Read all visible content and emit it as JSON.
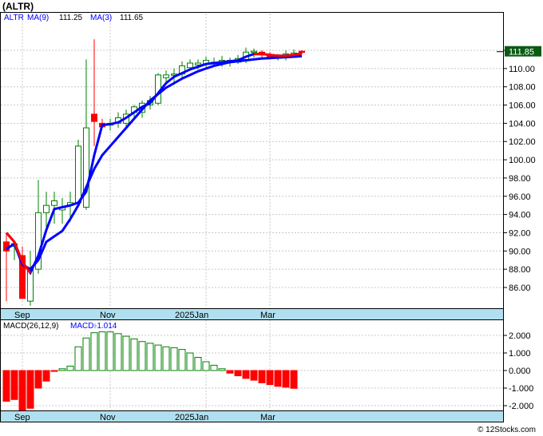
{
  "title": "(ALTR)",
  "watermark": "© 12Stocks.com",
  "chart_data": [
    {
      "type": "candlestick",
      "ticker_label": "ALTR",
      "legend": [
        {
          "label": "MA(9)",
          "value": "111.25",
          "color": "#0000ff"
        },
        {
          "label": "MA(3)",
          "value": "111.65",
          "color": "#0000ff"
        }
      ],
      "last_price": "111.85",
      "ylim": [
        84,
        113.6
      ],
      "yticks": [
        "86.00",
        "88.00",
        "90.00",
        "92.00",
        "94.00",
        "96.00",
        "98.00",
        "100.00",
        "102.00",
        "104.00",
        "106.00",
        "108.00",
        "110.00",
        "112.00"
      ],
      "xticks": [
        "Sep",
        "Nov",
        "2025Jan",
        "Mar"
      ],
      "colors": {
        "up": "#008000",
        "down": "#ff0000",
        "ma": "#0000ff",
        "ma_short": "#ff0000",
        "axis_band": "#b0e0f0"
      },
      "candles": [
        {
          "o": 91.0,
          "h": 92.0,
          "l": 84.5,
          "c": 90.0
        },
        {
          "o": 90.5,
          "h": 91.0,
          "l": 89.0,
          "c": 90.8
        },
        {
          "o": 89.5,
          "h": 90.5,
          "l": 84.8,
          "c": 84.8
        },
        {
          "o": 84.5,
          "h": 90.0,
          "l": 84.0,
          "c": 88.0
        },
        {
          "o": 88.0,
          "h": 97.8,
          "l": 87.5,
          "c": 94.2
        },
        {
          "o": 94.2,
          "h": 96.5,
          "l": 92.5,
          "c": 95.0
        },
        {
          "o": 95.0,
          "h": 96.5,
          "l": 93.0,
          "c": 95.5
        },
        {
          "o": 94.5,
          "h": 95.8,
          "l": 93.0,
          "c": 94.8
        },
        {
          "o": 95.0,
          "h": 96.5,
          "l": 93.2,
          "c": 95.3
        },
        {
          "o": 95.3,
          "h": 102.2,
          "l": 94.8,
          "c": 101.5
        },
        {
          "o": 94.8,
          "h": 111.0,
          "l": 94.5,
          "c": 103.5
        },
        {
          "o": 105.0,
          "h": 113.2,
          "l": 101.5,
          "c": 104.2
        },
        {
          "o": 104.0,
          "h": 104.5,
          "l": 103.5,
          "c": 103.6
        },
        {
          "o": 103.8,
          "h": 104.5,
          "l": 103.2,
          "c": 104.0
        },
        {
          "o": 104.0,
          "h": 105.2,
          "l": 103.5,
          "c": 104.6
        },
        {
          "o": 104.0,
          "h": 105.5,
          "l": 103.5,
          "c": 105.0
        },
        {
          "o": 105.2,
          "h": 106.0,
          "l": 104.5,
          "c": 105.8
        },
        {
          "o": 105.2,
          "h": 106.5,
          "l": 104.6,
          "c": 106.2
        },
        {
          "o": 106.0,
          "h": 107.0,
          "l": 105.5,
          "c": 106.5
        },
        {
          "o": 106.2,
          "h": 109.5,
          "l": 106.0,
          "c": 109.3
        },
        {
          "o": 109.0,
          "h": 109.8,
          "l": 108.5,
          "c": 109.3
        },
        {
          "o": 109.3,
          "h": 110.0,
          "l": 108.2,
          "c": 109.4
        },
        {
          "o": 109.4,
          "h": 110.8,
          "l": 108.8,
          "c": 110.3
        },
        {
          "o": 110.1,
          "h": 111.0,
          "l": 109.8,
          "c": 110.6
        },
        {
          "o": 110.4,
          "h": 111.0,
          "l": 109.9,
          "c": 110.6
        },
        {
          "o": 110.5,
          "h": 111.3,
          "l": 110.0,
          "c": 110.9
        },
        {
          "o": 110.6,
          "h": 111.2,
          "l": 110.2,
          "c": 110.7
        },
        {
          "o": 110.6,
          "h": 111.4,
          "l": 110.2,
          "c": 110.9
        },
        {
          "o": 110.7,
          "h": 111.2,
          "l": 110.2,
          "c": 110.9
        },
        {
          "o": 110.7,
          "h": 111.5,
          "l": 110.5,
          "c": 111.1
        },
        {
          "o": 111.0,
          "h": 112.3,
          "l": 110.6,
          "c": 111.8
        },
        {
          "o": 111.8,
          "h": 112.2,
          "l": 111.2,
          "c": 111.9
        },
        {
          "o": 111.8,
          "h": 112.0,
          "l": 111.2,
          "c": 111.5
        },
        {
          "o": 111.5,
          "h": 111.8,
          "l": 111.0,
          "c": 111.3
        },
        {
          "o": 111.2,
          "h": 111.6,
          "l": 110.9,
          "c": 111.4
        },
        {
          "o": 111.3,
          "h": 112.0,
          "l": 110.9,
          "c": 111.6
        },
        {
          "o": 111.5,
          "h": 112.1,
          "l": 111.2,
          "c": 111.7
        },
        {
          "o": 111.9,
          "h": 112.0,
          "l": 111.6,
          "c": 111.8
        }
      ],
      "ma_long": [
        90.2,
        90.8,
        88.5,
        88.0,
        89.0,
        91.0,
        91.6,
        92.2,
        93.5,
        95.0,
        97.0,
        99.0,
        100.5,
        101.5,
        102.5,
        103.5,
        104.5,
        105.5,
        106.5,
        107.2,
        107.9,
        108.4,
        108.9,
        109.3,
        109.7,
        110.0,
        110.3,
        110.5,
        110.7,
        110.8,
        110.9,
        111.0,
        111.1,
        111.15,
        111.2,
        111.25,
        111.3,
        111.35
      ],
      "ma_short": [
        92.0,
        91.0,
        88.8,
        87.6,
        89.5,
        92.3,
        94.6,
        94.8,
        95.0,
        95.3,
        96.5,
        100.5,
        103.8,
        103.9,
        104.1,
        104.6,
        105.2,
        105.8,
        106.2,
        107.3,
        108.4,
        109.1,
        109.5,
        109.9,
        110.2,
        110.5,
        110.6,
        110.7,
        110.8,
        110.9,
        111.3,
        111.6,
        111.6,
        111.5,
        111.4,
        111.4,
        111.5,
        111.65
      ],
      "ma_short_red_segments": [
        [
          0,
          3
        ],
        [
          31,
          37
        ]
      ]
    },
    {
      "type": "bar",
      "label": "MACD(26,12,9)",
      "legend_value_label": "MACD:",
      "legend_value": "-1.014",
      "ylim": [
        -2.25,
        2.5
      ],
      "yticks": [
        "2.000",
        "1.000",
        "0.000",
        "-1.000",
        "-2.000"
      ],
      "xticks": [
        "Sep",
        "Nov",
        "2025Jan",
        "Mar"
      ],
      "values": [
        -1.75,
        -1.65,
        -2.25,
        -2.15,
        -1.0,
        -0.6,
        -0.05,
        0.1,
        0.25,
        1.35,
        1.85,
        2.15,
        2.2,
        2.2,
        2.1,
        1.95,
        1.8,
        1.65,
        1.55,
        1.45,
        1.35,
        1.3,
        1.2,
        1.0,
        0.75,
        0.5,
        0.3,
        0.1,
        -0.15,
        -0.3,
        -0.45,
        -0.55,
        -0.7,
        -0.8,
        -0.9,
        -0.95,
        -1.014
      ]
    }
  ]
}
